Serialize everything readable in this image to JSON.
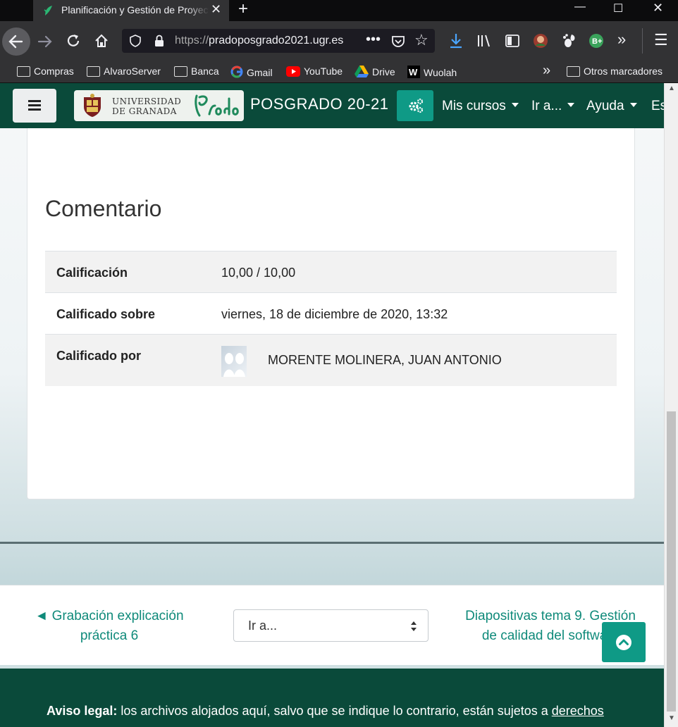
{
  "browser": {
    "tab_title": "Planificación y Gestión de Proyectos",
    "url_prefix": "https://",
    "url_host": "pradoposgrado2021.ugr.es",
    "bookmarks": [
      "Compras",
      "AlvaroServer",
      "Banca",
      "Gmail",
      "YouTube",
      "Drive",
      "Wuolah",
      "Otros marcadores"
    ]
  },
  "site": {
    "logo_text_line1": "UNIVERSIDAD",
    "logo_text_line2": "DE GRANADA",
    "logo_script": "Prado",
    "name": "POSGRADO 20-21",
    "menu": [
      "Mis cursos",
      "Ir a...",
      "Ayuda",
      "Es"
    ]
  },
  "feedback": {
    "title": "Comentario",
    "rows": [
      {
        "label": "Calificación",
        "value": "10,00 / 10,00"
      },
      {
        "label": "Calificado sobre",
        "value": "viernes, 18 de diciembre de 2020, 13:32"
      },
      {
        "label": "Calificado por",
        "value": "MORENTE MOLINERA, JUAN ANTONIO"
      }
    ]
  },
  "activity_nav": {
    "prev_line1": "◄ Grabación explicación",
    "prev_line2": "práctica 6",
    "jump_label": "Ir a...",
    "next_line1": "Diapositivas tema 9. Gestión",
    "next_line2": "de calidad del software"
  },
  "footer": {
    "legal_bold": "Aviso legal:",
    "legal_text": " los archivos alojados aquí, salvo que se indique lo contrario, están sujetos a ",
    "legal_link": "derechos"
  },
  "colors": {
    "nav_bg": "#0a4a3a",
    "accent": "#0f9a86",
    "link": "#0f8a7a"
  }
}
